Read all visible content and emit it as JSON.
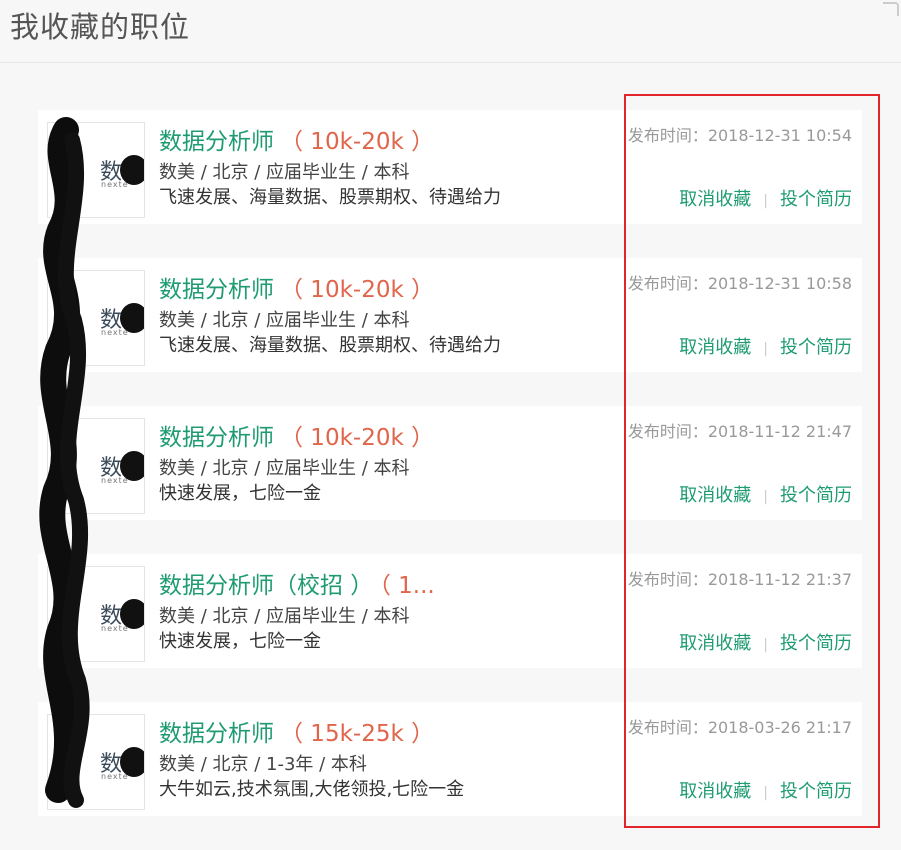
{
  "page": {
    "title": "我收藏的职位"
  },
  "jobs": [
    {
      "title": "数据分析师",
      "salary": "（ 10k-20k ）",
      "meta": "数美 / 北京 / 应届毕业生 / 本科",
      "perks": "飞速发展、海量数据、股票期权、待遇给力",
      "post_time": "发布时间：2018-12-31 10:54",
      "logo_text": "数",
      "logo_sub": "nexte"
    },
    {
      "title": "数据分析师",
      "salary": "（ 10k-20k ）",
      "meta": "数美 / 北京 / 应届毕业生 / 本科",
      "perks": "飞速发展、海量数据、股票期权、待遇给力",
      "post_time": "发布时间：2018-12-31 10:58",
      "logo_text": "数",
      "logo_sub": "nexte"
    },
    {
      "title": "数据分析师",
      "salary": "（ 10k-20k ）",
      "meta": "数美 / 北京 / 应届毕业生 / 本科",
      "perks": "快速发展，七险一金",
      "post_time": "发布时间：2018-11-12 21:47",
      "logo_text": "数",
      "logo_sub": "nexte"
    },
    {
      "title": "数据分析师（校招 ）",
      "salary": "（ 1...",
      "meta": "数美 / 北京 / 应届毕业生 / 本科",
      "perks": "快速发展，七险一金",
      "post_time": "发布时间：2018-11-12 21:37",
      "logo_text": "数",
      "logo_sub": "nexte"
    },
    {
      "title": "数据分析师",
      "salary": "（ 15k-25k ）",
      "meta": "数美 / 北京 / 1-3年 / 本科",
      "perks": "大牛如云,技术氛围,大佬领投,七险一金",
      "post_time": "发布时间：2018-03-26 21:17",
      "logo_text": "数",
      "logo_sub": "nexte"
    }
  ],
  "actions": {
    "cancel_favorite": "取消收藏",
    "separator": "|",
    "apply_resume": "投个简历"
  },
  "colors": {
    "accent_green": "#1f9b73",
    "salary_orange": "#e0654a",
    "highlight_red": "#e0262b"
  }
}
